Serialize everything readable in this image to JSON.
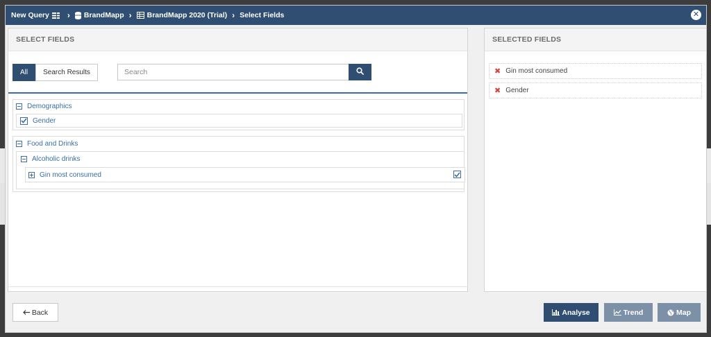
{
  "breadcrumb": {
    "items": [
      {
        "label": "New Query",
        "icon": "list-icon"
      },
      {
        "label": "BrandMapp",
        "icon": "database-icon"
      },
      {
        "label": "BrandMapp 2020 (Trial)",
        "icon": "table-icon"
      },
      {
        "label": "Select Fields",
        "icon": ""
      }
    ]
  },
  "left_panel": {
    "title": "SELECT FIELDS",
    "tabs": [
      {
        "label": "All",
        "active": true
      },
      {
        "label": "Search Results",
        "active": false
      }
    ],
    "search": {
      "placeholder": "Search",
      "value": ""
    },
    "tree": {
      "demographics": {
        "label": "Demographics",
        "children": [
          {
            "label": "Gender",
            "checked": true
          }
        ]
      },
      "food_and_drinks": {
        "label": "Food and Drinks",
        "alcoholic": {
          "label": "Alcoholic drinks",
          "children": [
            {
              "label": "Gin most consumed",
              "checked": true
            }
          ]
        }
      }
    }
  },
  "right_panel": {
    "title": "SELECTED FIELDS",
    "items": [
      {
        "label": "Gin most consumed"
      },
      {
        "label": "Gender"
      }
    ]
  },
  "footer": {
    "back_label": "Back",
    "analyse_label": "Analyse",
    "trend_label": "Trend",
    "map_label": "Map"
  },
  "colors": {
    "header": "#2f4e72",
    "primary_button": "#2f4e72",
    "disabled_button": "#7c91a8",
    "link": "#3a6ea5",
    "remove": "#d64541"
  }
}
